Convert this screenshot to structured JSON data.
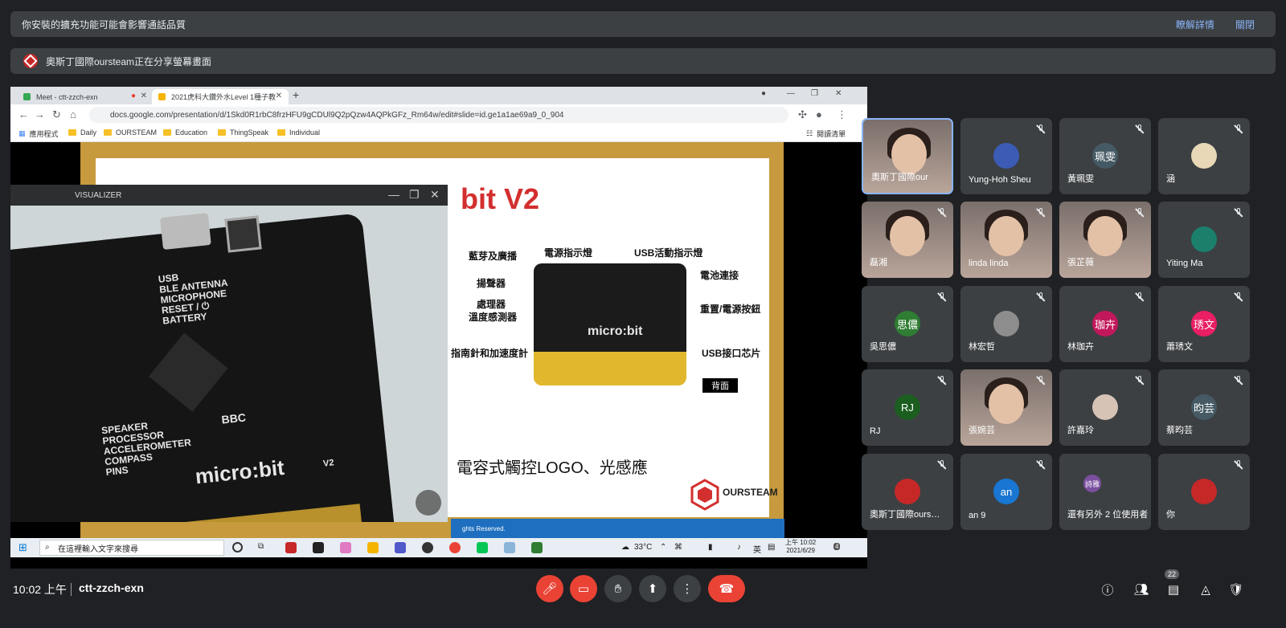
{
  "banners": {
    "extension_warning": "你安裝的擴充功能可能會影響通話品質",
    "learn_more": "瞭解詳情",
    "close": "關閉",
    "presenting": "奧斯丁國際oursteam正在分享螢幕畫面"
  },
  "browser": {
    "tabs": [
      {
        "label": "Meet - ctt-zzch-exn",
        "active": false
      },
      {
        "label": "2021虎科大鑽外水Level 1種子教",
        "active": true
      }
    ],
    "url": "docs.google.com/presentation/d/1Skd0R1rbC8frzHFU9gCDUl9Q2pQzw4AQPkGFz_Rm64w/edit#slide=id.ge1a1ae69a9_0_904",
    "bookmarks": [
      "應用程式",
      "Daily",
      "OURSTEAM",
      "Education",
      "ThingSpeak",
      "Individual"
    ],
    "reading_list": "閱讀清單"
  },
  "slide": {
    "title": "bit V2",
    "labels": {
      "bt": "藍芽及廣播",
      "power_led": "電源指示燈",
      "usb_led": "USB活動指示燈",
      "speaker": "揚聲器",
      "battery": "電池連接",
      "cpu1": "處理器",
      "cpu2": "溫度感測器",
      "reset": "重置/電源按鈕",
      "compass": "指南針和加速度計",
      "usb_chip": "USB接口芯片",
      "back": "背面"
    },
    "feature": "電容式觸控LOGO、光感應",
    "footer": "ghts Reserved.",
    "brand": "OURSTEAM"
  },
  "visualizer": {
    "title": "VISUALIZER",
    "board_labels": [
      "USB",
      "BLE ANTENNA",
      "MICROPHONE",
      "RESET / ⏻",
      "BATTERY",
      "SPEAKER",
      "PROCESSOR",
      "ACCELEROMETER",
      "COMPASS",
      "PINS",
      "BBC",
      "micro:bit",
      "V2"
    ]
  },
  "taskbar": {
    "search_placeholder": "在這裡輸入文字來搜尋",
    "temp": "33°C",
    "ime": "英",
    "time": "上午 10:02",
    "date": "2021/6/29",
    "notif_count": "4"
  },
  "participants": [
    {
      "name": "奧斯丁國際our",
      "type": "video"
    },
    {
      "name": "Yung-Hoh Sheu",
      "type": "avatar",
      "initial": "",
      "color": "#3b5bb5"
    },
    {
      "name": "黃珮雯",
      "type": "avatar",
      "initial": "珮雯",
      "color": "#455a64"
    },
    {
      "name": "涵",
      "type": "avatar",
      "initial": "",
      "color": "#e8d8b8"
    },
    {
      "name": "磊湘",
      "type": "video"
    },
    {
      "name": "linda linda",
      "type": "video"
    },
    {
      "name": "張芷薇",
      "type": "video"
    },
    {
      "name": "Yiting Ma",
      "type": "avatar",
      "initial": "",
      "color": "#1b7f6b"
    },
    {
      "name": "吳思儂",
      "type": "avatar",
      "initial": "思儂",
      "color": "#2e7d32"
    },
    {
      "name": "林宏哲",
      "type": "avatar",
      "initial": "",
      "color": "#8d8d8d"
    },
    {
      "name": "林珈卉",
      "type": "avatar",
      "initial": "珈卉",
      "color": "#c2185b"
    },
    {
      "name": "蕭琇文",
      "type": "avatar",
      "initial": "琇文",
      "color": "#e91e63"
    },
    {
      "name": "RJ",
      "type": "avatar",
      "initial": "RJ",
      "color": "#1b5e20"
    },
    {
      "name": "張婉芸",
      "type": "video"
    },
    {
      "name": "許嘉玲",
      "type": "avatar",
      "initial": "",
      "color": "#d7c3b5"
    },
    {
      "name": "蔡昀芸",
      "type": "avatar",
      "initial": "昀芸",
      "color": "#455a64"
    },
    {
      "name": "奧斯丁國際ours…",
      "type": "avatar",
      "initial": "",
      "color": "#c62828"
    },
    {
      "name": "an 9",
      "type": "avatar",
      "initial": "an",
      "color": "#1976d2"
    },
    {
      "name": "還有另外 2 位使用者",
      "type": "others",
      "initial": "詩雅",
      "color": "#7b4fa0"
    },
    {
      "name": "你",
      "type": "avatar",
      "initial": "",
      "color": "#c62828"
    }
  ],
  "bottom": {
    "time": "10:02 上午",
    "meeting_code": "ctt-zzch-exn",
    "people_count": "22"
  }
}
